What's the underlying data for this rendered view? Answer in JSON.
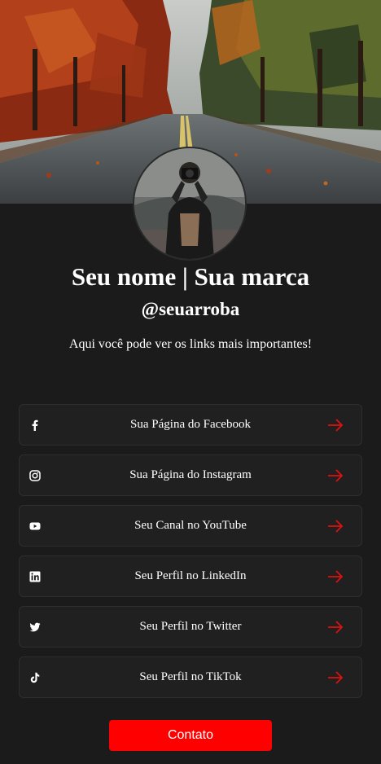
{
  "profile": {
    "name": "Seu nome | Sua marca",
    "handle": "@seuarroba",
    "tagline": "Aqui você pode ver os links mais importantes!"
  },
  "links": [
    {
      "label": "Sua Página do Facebook",
      "icon": "facebook-icon"
    },
    {
      "label": "Sua Página do Instagram",
      "icon": "instagram-icon"
    },
    {
      "label": "Seu Canal no YouTube",
      "icon": "youtube-icon"
    },
    {
      "label": "Seu Perfil no LinkedIn",
      "icon": "linkedin-icon"
    },
    {
      "label": "Seu Perfil no Twitter",
      "icon": "twitter-icon"
    },
    {
      "label": "Seu Perfil no TikTok",
      "icon": "tiktok-icon"
    }
  ],
  "contact_button": "Contato",
  "colors": {
    "background": "#1b1b1b",
    "card": "#202020",
    "accent": "#ff0000",
    "arrow": "#e01010"
  }
}
